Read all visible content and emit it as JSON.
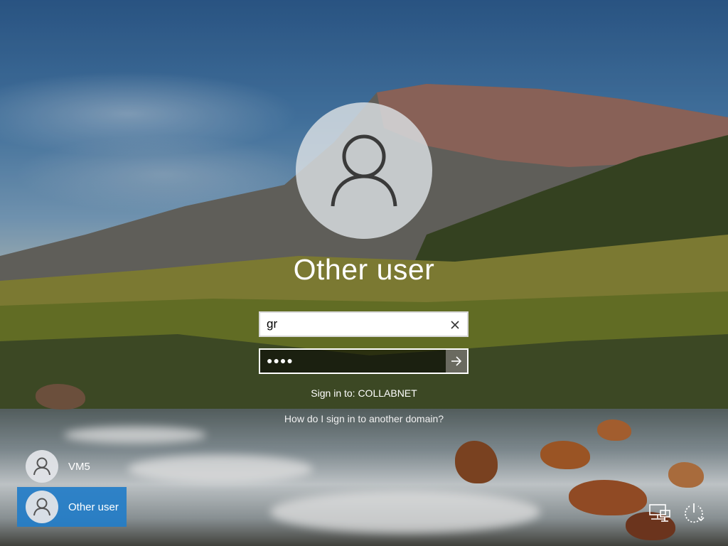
{
  "signin": {
    "user_title": "Other user",
    "username_value": "gr",
    "password_mask": "●●●●",
    "sign_in_to": "Sign in to: COLLABNET",
    "other_domain_link": "How do I sign in to another domain?"
  },
  "users": {
    "items": [
      {
        "label": "VM5",
        "selected": false
      },
      {
        "label": "Other user",
        "selected": true
      }
    ]
  },
  "icons": {
    "avatar": "person-icon",
    "clear": "clear-x-icon",
    "submit": "arrow-right-icon",
    "network": "network-icon",
    "power": "power-icon"
  },
  "colors": {
    "selected_user": "#237dc8",
    "password_field_border": "#ffffff"
  }
}
